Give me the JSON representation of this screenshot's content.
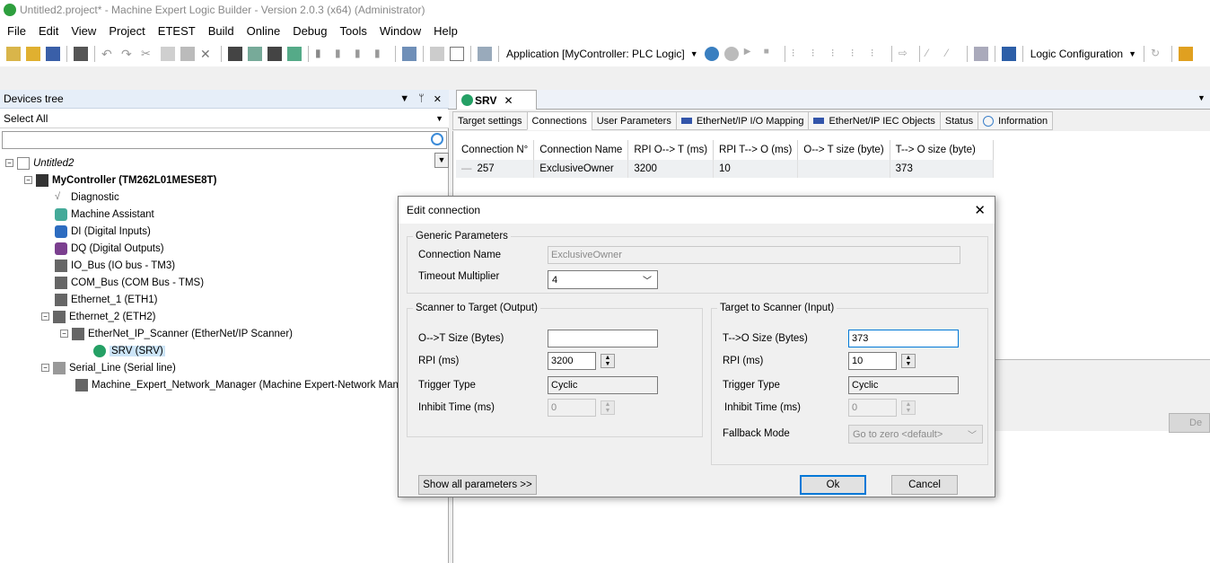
{
  "window": {
    "title": "Untitled2.project* - Machine Expert Logic Builder - Version 2.0.3 (x64) (Administrator)"
  },
  "menu": [
    "File",
    "Edit",
    "View",
    "Project",
    "ETEST",
    "Build",
    "Online",
    "Debug",
    "Tools",
    "Window",
    "Help"
  ],
  "toolbar": {
    "application_combo": "Application [MyController: PLC Logic]",
    "config_combo": "Logic Configuration"
  },
  "devices": {
    "title": "Devices tree",
    "filter": "Select All",
    "tree": [
      {
        "label": "Untitled2",
        "italic": true
      },
      {
        "label": "MyController (TM262L01MESE8T)",
        "bold": true
      },
      {
        "label": "Diagnostic"
      },
      {
        "label": "Machine Assistant"
      },
      {
        "label": "DI (Digital Inputs)"
      },
      {
        "label": "DQ (Digital Outputs)"
      },
      {
        "label": "IO_Bus (IO bus - TM3)"
      },
      {
        "label": "COM_Bus (COM Bus - TMS)"
      },
      {
        "label": "Ethernet_1 (ETH1)"
      },
      {
        "label": "Ethernet_2 (ETH2)"
      },
      {
        "label": "EtherNet_IP_Scanner (EtherNet/IP Scanner)"
      },
      {
        "label": "SRV (SRV)",
        "selected": true
      },
      {
        "label": "Serial_Line (Serial line)"
      },
      {
        "label": "Machine_Expert_Network_Manager (Machine Expert-Network Manage"
      }
    ]
  },
  "editor": {
    "tab": "SRV",
    "subtabs": [
      "Target settings",
      "Connections",
      "User Parameters",
      "EtherNet/IP I/O Mapping",
      "EtherNet/IP IEC Objects",
      "Status",
      "Information"
    ],
    "active_subtab": "Connections",
    "table": {
      "headers": [
        "Connection N°",
        "Connection Name",
        "RPI O--> T (ms)",
        "RPI T--> O (ms)",
        "O--> T size (byte)",
        "T--> O size (byte)"
      ],
      "rows": [
        [
          "257",
          "ExclusiveOwner",
          "3200",
          "10",
          "",
          "373"
        ]
      ]
    },
    "lower_button": "De"
  },
  "dialog": {
    "title": "Edit connection",
    "generic": {
      "legend": "Generic Parameters",
      "connection_name_label": "Connection Name",
      "connection_name_value": "ExclusiveOwner",
      "timeout_label": "Timeout Multiplier",
      "timeout_value": "4"
    },
    "output": {
      "legend": "Scanner to Target (Output)",
      "size_label": "O-->T Size (Bytes)",
      "size_value": "",
      "rpi_label": "RPI (ms)",
      "rpi_value": "3200",
      "trigger_label": "Trigger Type",
      "trigger_value": "Cyclic",
      "inhibit_label": "Inhibit Time (ms)",
      "inhibit_value": "0"
    },
    "input": {
      "legend": "Target to Scanner (Input)",
      "size_label": "T-->O Size (Bytes)",
      "size_value": "373",
      "rpi_label": "RPI (ms)",
      "rpi_value": "10",
      "trigger_label": "Trigger Type",
      "trigger_value": "Cyclic",
      "inhibit_label": "Inhibit Time (ms)",
      "inhibit_value": "0",
      "fallback_label": "Fallback Mode",
      "fallback_value": "Go to zero <default>"
    },
    "show_all_button": "Show all parameters >>",
    "ok_button": "Ok",
    "cancel_button": "Cancel"
  }
}
